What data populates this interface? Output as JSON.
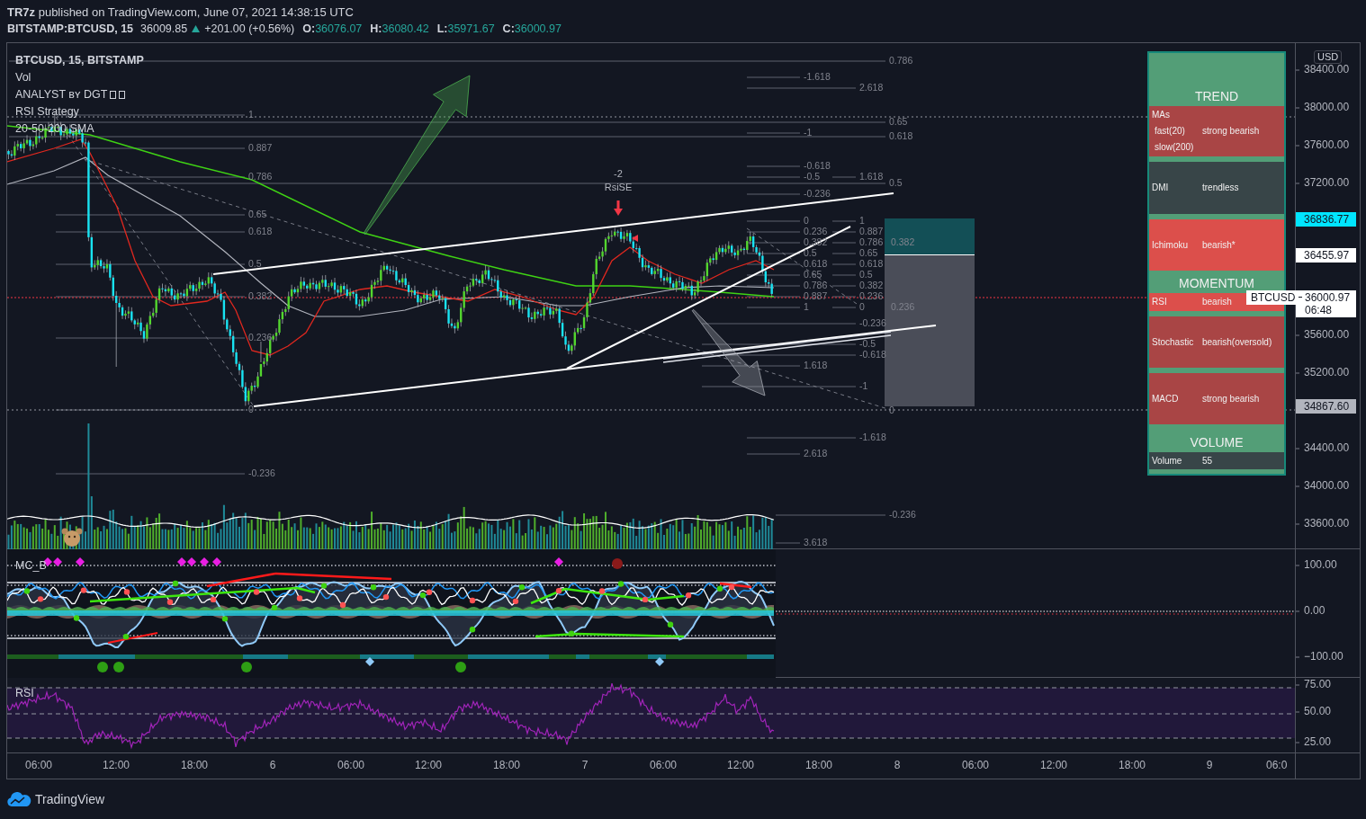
{
  "header": {
    "byline": "**TR7z** published on TradingView.com, June 07, 2021 14:38:15 UTC"
  },
  "quote": {
    "symbol": "BITSTAMP:BTCUSD, 15",
    "price": "36009.85",
    "change": "+201.00 (+0.56%)",
    "ohlc": [
      {
        "key": "O:",
        "value": "36076.07"
      },
      {
        "key": "H:",
        "value": "36080.42"
      },
      {
        "key": "L:",
        "value": "35971.67"
      },
      {
        "key": "C:",
        "value": "36000.97"
      }
    ]
  },
  "legend": {
    "title": "BTCUSD, 15, BITSTAMP",
    "indicators": [
      {
        "name": "Vol",
        "kind": "plain"
      },
      {
        "name": "ANALYST ʙʏ DGT",
        "kind": "glyphs"
      },
      {
        "name": "RSI Strategy",
        "kind": "plain"
      },
      {
        "name": "20-50-200 SMA",
        "kind": "plain"
      }
    ]
  },
  "signal": {
    "count": "-2",
    "name": "RsiSE"
  },
  "fib_labels": [
    "0.786",
    "-1.618",
    "2.618",
    "1",
    "0.65",
    "-1",
    "0.618",
    "0.887",
    "-0.618",
    "0.786",
    "-0.5",
    "1.618",
    "0.5",
    "-0.236",
    "0.65",
    "0",
    "1",
    "0.618",
    "0.236",
    "0.887",
    "0.382",
    "0.786",
    "0.382",
    "0.5",
    "0.65",
    "0.5",
    "0.618",
    "0.618",
    "0.65",
    "0.5",
    "0.786",
    "0.382",
    "0.382",
    "0.887",
    "0.236",
    "1",
    "0",
    "0.236",
    "-0.236",
    "0.236",
    "-0.5",
    "-0.618",
    "1.618",
    "-1",
    "0",
    "0",
    "-1.618",
    "2.618",
    "-0.236",
    "-0.236",
    "3.618"
  ],
  "dashboard": {
    "rows": [
      {
        "kind": "header",
        "label": "TREND"
      },
      {
        "kind": "group",
        "color": "#a94545",
        "label": "MAs",
        "lines": [
          {
            "label": "fast(20)",
            "value": "strong bearish"
          },
          {
            "label": "slow(200)"
          }
        ]
      },
      {
        "kind": "row",
        "color": "#384548",
        "label": "DMI",
        "value": "trendless"
      },
      {
        "kind": "row",
        "color": "#dc4f4b",
        "label": "Ichimoku",
        "value": "bearish*"
      },
      {
        "kind": "header",
        "label": "MOMENTUM"
      },
      {
        "kind": "row",
        "color": "#dc4f4b",
        "label": "RSI",
        "value": "bearish"
      },
      {
        "kind": "row",
        "color": "#a94545",
        "label": "Stochastic",
        "value": "bearish(oversold)"
      },
      {
        "kind": "row",
        "color": "#a94545",
        "label": "MACD",
        "value": "strong bearish"
      },
      {
        "kind": "header",
        "label": "VOLUME"
      },
      {
        "kind": "row",
        "color": "#384548",
        "label": "Volume",
        "value": "55"
      }
    ]
  },
  "price_axis": {
    "unit": "USD",
    "ticks": [
      "38400.00",
      "38000.00",
      "37600.00",
      "37200.00",
      "35600.00",
      "35200.00",
      "34400.00",
      "34000.00",
      "33600.00"
    ],
    "badges": [
      {
        "kind": "marker",
        "value": "36836.77"
      },
      {
        "kind": "line",
        "value": "36455.97"
      },
      {
        "kind": "last",
        "symbol": "BTCUSD",
        "value": "36000.97",
        "countdown": "06:48"
      },
      {
        "kind": "level",
        "value": "34867.60"
      }
    ]
  },
  "oscillator_pane": {
    "title": "MC_B",
    "ticks": [
      "100.00",
      "0.00",
      "−100.00"
    ]
  },
  "rsi_pane": {
    "title": "RSI",
    "ticks": [
      "75.00",
      "50.00",
      "25.00"
    ]
  },
  "time_axis": [
    "06:00",
    "12:00",
    "18:00",
    "6",
    "06:00",
    "12:00",
    "18:00",
    "7",
    "06:00",
    "12:00",
    "18:00",
    "8",
    "06:00",
    "12:00",
    "18:00",
    "9",
    "06:0"
  ],
  "footer": {
    "brand": "TradingView"
  }
}
